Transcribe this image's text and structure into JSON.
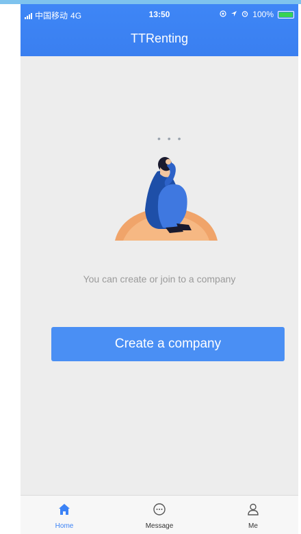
{
  "status_bar": {
    "carrier": "中国移动",
    "network": "4G",
    "time": "13:50",
    "battery": "100%"
  },
  "header": {
    "title": "TTRenting"
  },
  "empty_state": {
    "dots": "• • •",
    "message": "You can create or join to a company",
    "button_label": "Create a company"
  },
  "tabbar": {
    "items": [
      {
        "label": "Home",
        "icon": "home-icon",
        "active": true
      },
      {
        "label": "Message",
        "icon": "message-icon",
        "active": false
      },
      {
        "label": "Me",
        "icon": "person-icon",
        "active": false
      }
    ]
  },
  "colors": {
    "accent": "#3b82f6",
    "button": "#4a8ff4",
    "background": "#ededed"
  }
}
